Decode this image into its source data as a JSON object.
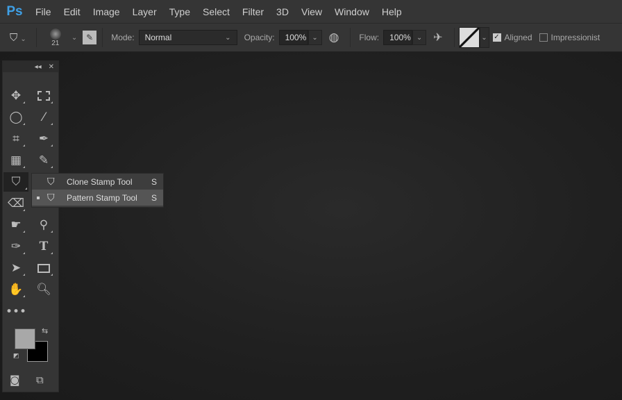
{
  "app": {
    "logo": "Ps"
  },
  "menu": [
    "File",
    "Edit",
    "Image",
    "Layer",
    "Type",
    "Select",
    "Filter",
    "3D",
    "View",
    "Window",
    "Help"
  ],
  "options": {
    "brush_size": "21",
    "mode_label": "Mode:",
    "mode_value": "Normal",
    "opacity_label": "Opacity:",
    "opacity_value": "100%",
    "flow_label": "Flow:",
    "flow_value": "100%",
    "aligned_label": "Aligned",
    "aligned_checked": true,
    "impressionist_label": "Impressionist",
    "impressionist_checked": false
  },
  "toolbox": {
    "collapse": "◂◂",
    "close": "✕"
  },
  "flyout": {
    "items": [
      {
        "label": "Clone Stamp Tool",
        "shortcut": "S",
        "selected": false
      },
      {
        "label": "Pattern Stamp Tool",
        "shortcut": "S",
        "selected": true
      }
    ]
  },
  "colors": {
    "foreground": "#a8a8a8",
    "background": "#000000",
    "accent": "#3fa0e6"
  }
}
